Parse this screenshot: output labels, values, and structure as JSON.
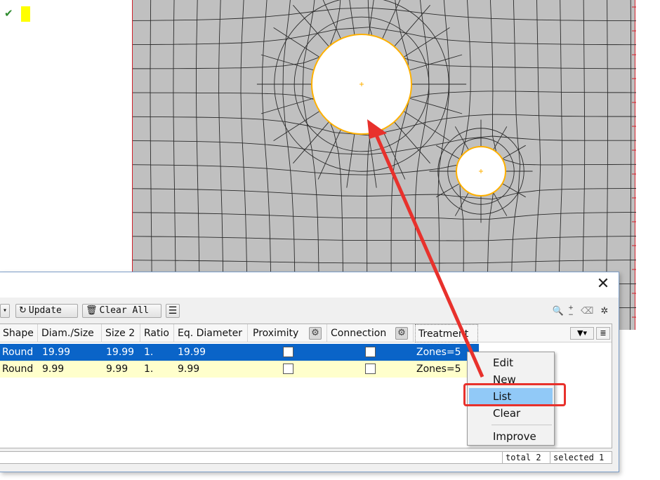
{
  "toolbar": {
    "dropdown_glyph": "▾",
    "update_label": "Update",
    "clear_all_label": "Clear All"
  },
  "table": {
    "columns": [
      "Shape",
      "Diam./Size",
      "Size 2",
      "Ratio",
      "Eq. Diameter",
      "Proximity",
      "Connection",
      "Treatment"
    ],
    "rows": [
      {
        "shape": "Round",
        "diam": "19.99",
        "size2": "19.99",
        "ratio": "1.",
        "eq": "19.99",
        "proximity": false,
        "connection": false,
        "treatment": "Zones=5"
      },
      {
        "shape": "Round",
        "diam": "9.99",
        "size2": "9.99",
        "ratio": "1.",
        "eq": "9.99",
        "proximity": false,
        "connection": false,
        "treatment": "Zones=5"
      }
    ]
  },
  "status": {
    "total": "total 2",
    "selected": "selected 1"
  },
  "context_menu": {
    "items": [
      "Edit",
      "New",
      "List",
      "Clear",
      "Improve"
    ],
    "highlighted": "List"
  },
  "icons": {
    "check": "check-icon",
    "close": "close-icon",
    "refresh": "refresh-icon",
    "trash": "trash-icon",
    "menu": "menu-lines-icon",
    "zoom": "zoom-icon",
    "eraser": "eraser-icon",
    "cursor": "cursor-icon",
    "gear": "gear-icon",
    "filter": "filter-icon",
    "columns": "columns-icon"
  },
  "colors": {
    "mesh_fill": "#c0c0c0",
    "hole_edge": "#ffb000",
    "selection": "#0a64c8",
    "row_highlight": "#ffffcc",
    "menu_highlight": "#91c9f7",
    "annotation": "#e8312c"
  }
}
